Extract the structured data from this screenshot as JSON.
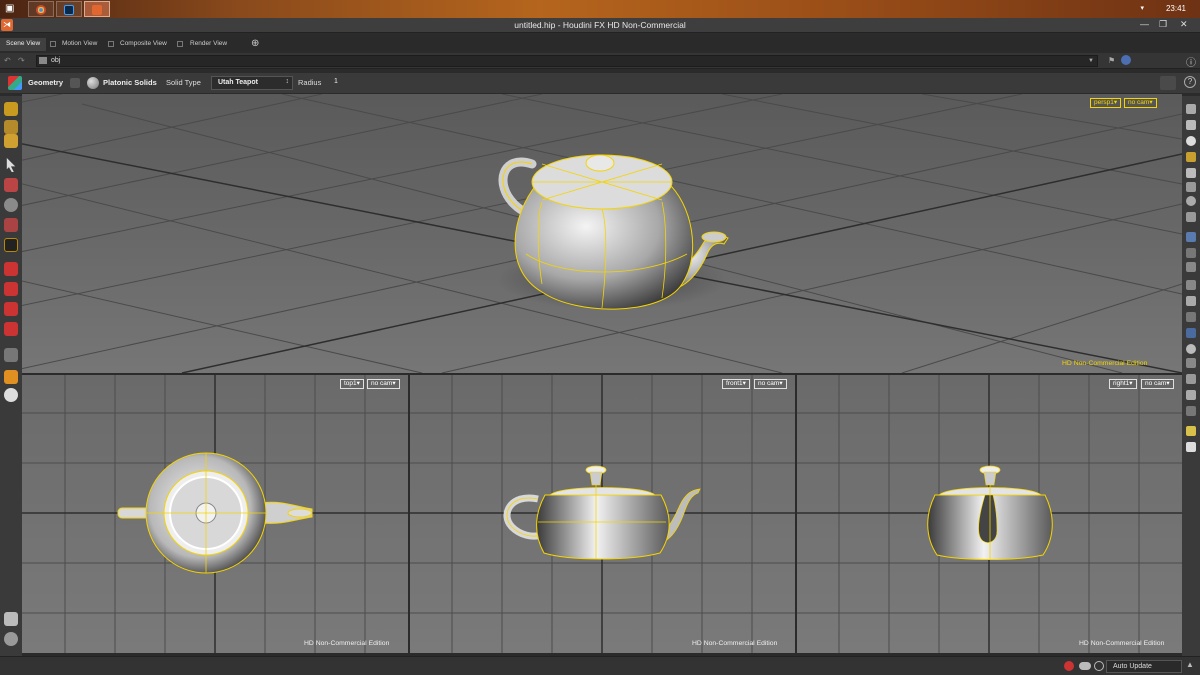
{
  "taskbar": {
    "clock": "23:41",
    "apps": [
      {
        "icon": "chrome-icon",
        "color": "#d04a2c"
      },
      {
        "icon": "photoshop-icon",
        "color": "#0b2a4a"
      },
      {
        "icon": "houdini-icon",
        "color": "#e06830"
      }
    ]
  },
  "window": {
    "title": "untitled.hip - Houdini FX HD Non-Commercial"
  },
  "tabs": [
    {
      "label": "Scene View",
      "active": true
    },
    {
      "label": "Motion View",
      "active": false
    },
    {
      "label": "Composite View",
      "active": false
    },
    {
      "label": "Render View",
      "active": false
    }
  ],
  "pathbar": {
    "path": "obj"
  },
  "operation": {
    "context": "Geometry",
    "tool": "Platonic Solids",
    "solid_type_label": "Solid Type",
    "solid_type_value": "Utah Teapot",
    "radius_label": "Radius",
    "radius_value": "1"
  },
  "viewports": {
    "persp": {
      "camera": "persp1▾",
      "cam": "no cam▾",
      "watermark": "HD Non-Commercial Edition"
    },
    "top": {
      "camera": "top1▾",
      "cam": "no cam▾",
      "watermark": "HD Non-Commercial Edition"
    },
    "front": {
      "camera": "front1▾",
      "cam": "no cam▾",
      "watermark": "HD Non-Commercial Edition"
    },
    "right": {
      "camera": "right1▾",
      "cam": "no cam▾",
      "watermark": "HD Non-Commercial Edition"
    }
  },
  "statusbar": {
    "update_mode": "Auto Update"
  },
  "colors": {
    "selection": "#f5d400",
    "viewport_bg": "#6a6a6a",
    "accent": "#e06830"
  }
}
